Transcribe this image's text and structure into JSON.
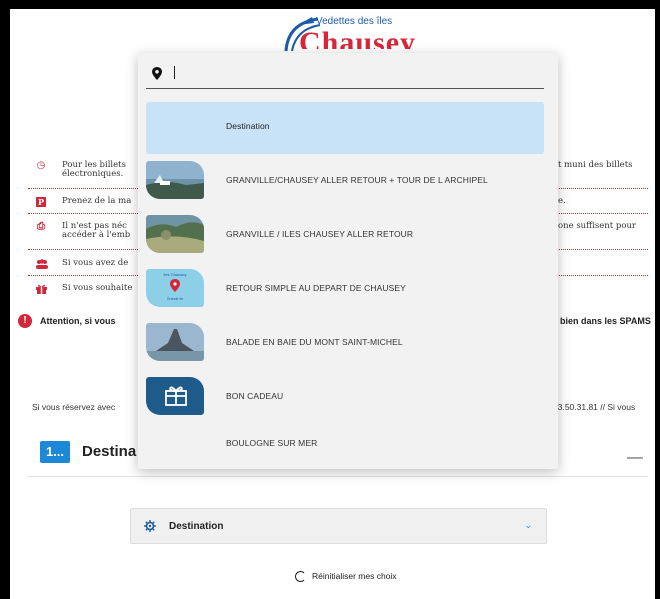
{
  "logo": {
    "tagline": "Vedettes des îles",
    "name": "Chausey"
  },
  "info": [
    {
      "icon": "clock-icon",
      "glyph": "◷",
      "text_left": "Pour les billets\nélectroniques.",
      "text_right": "t muni des billets"
    },
    {
      "icon": "parking-icon",
      "glyph": "P",
      "text_left": "Prenez de la ma",
      "text_right": "e."
    },
    {
      "icon": "printer-icon",
      "glyph": "⎙",
      "text_left": "Il n'est pas néc\naccéder à l'emb",
      "text_right": "one suffisent pour"
    },
    {
      "icon": "group-icon",
      "glyph": "👥",
      "text_left": "Si vous avez de",
      "text_right": ""
    },
    {
      "icon": "gift-icon",
      "glyph": "🎁",
      "text_left": "Si vous souhaite",
      "text_right": ""
    }
  ],
  "attention": {
    "left": "Attention, si vous",
    "right": "bien dans les SPAMS"
  },
  "reservation": {
    "left": "Si vous réservez avec",
    "right": "33.50.31.81 // Si vous"
  },
  "step": {
    "badge": "1...",
    "title": "Destina",
    "collapse": "—"
  },
  "destination_select": {
    "label": "Destination"
  },
  "reset_label": "Réinitialiser mes choix",
  "dropdown": {
    "search_value": "",
    "options": [
      {
        "label": "Destination",
        "selected": true,
        "thumb": ""
      },
      {
        "label": "GRANVILLE/CHAUSEY ALLER RETOUR + TOUR DE L ARCHIPEL",
        "thumb": "coast"
      },
      {
        "label": "GRANVILLE / ILES CHAUSEY ALLER RETOUR",
        "thumb": "rocks"
      },
      {
        "label": "RETOUR SIMPLE AU DEPART DE CHAUSEY",
        "thumb": "map",
        "thumb_text": "Iles Chausey",
        "thumb_sub": "Grande île"
      },
      {
        "label": "BALADE EN BAIE DU MONT SAINT-MICHEL",
        "thumb": "mont"
      },
      {
        "label": "BON CADEAU",
        "thumb": "gift"
      },
      {
        "label": "BOULOGNE SUR MER",
        "thumb": ""
      }
    ]
  }
}
